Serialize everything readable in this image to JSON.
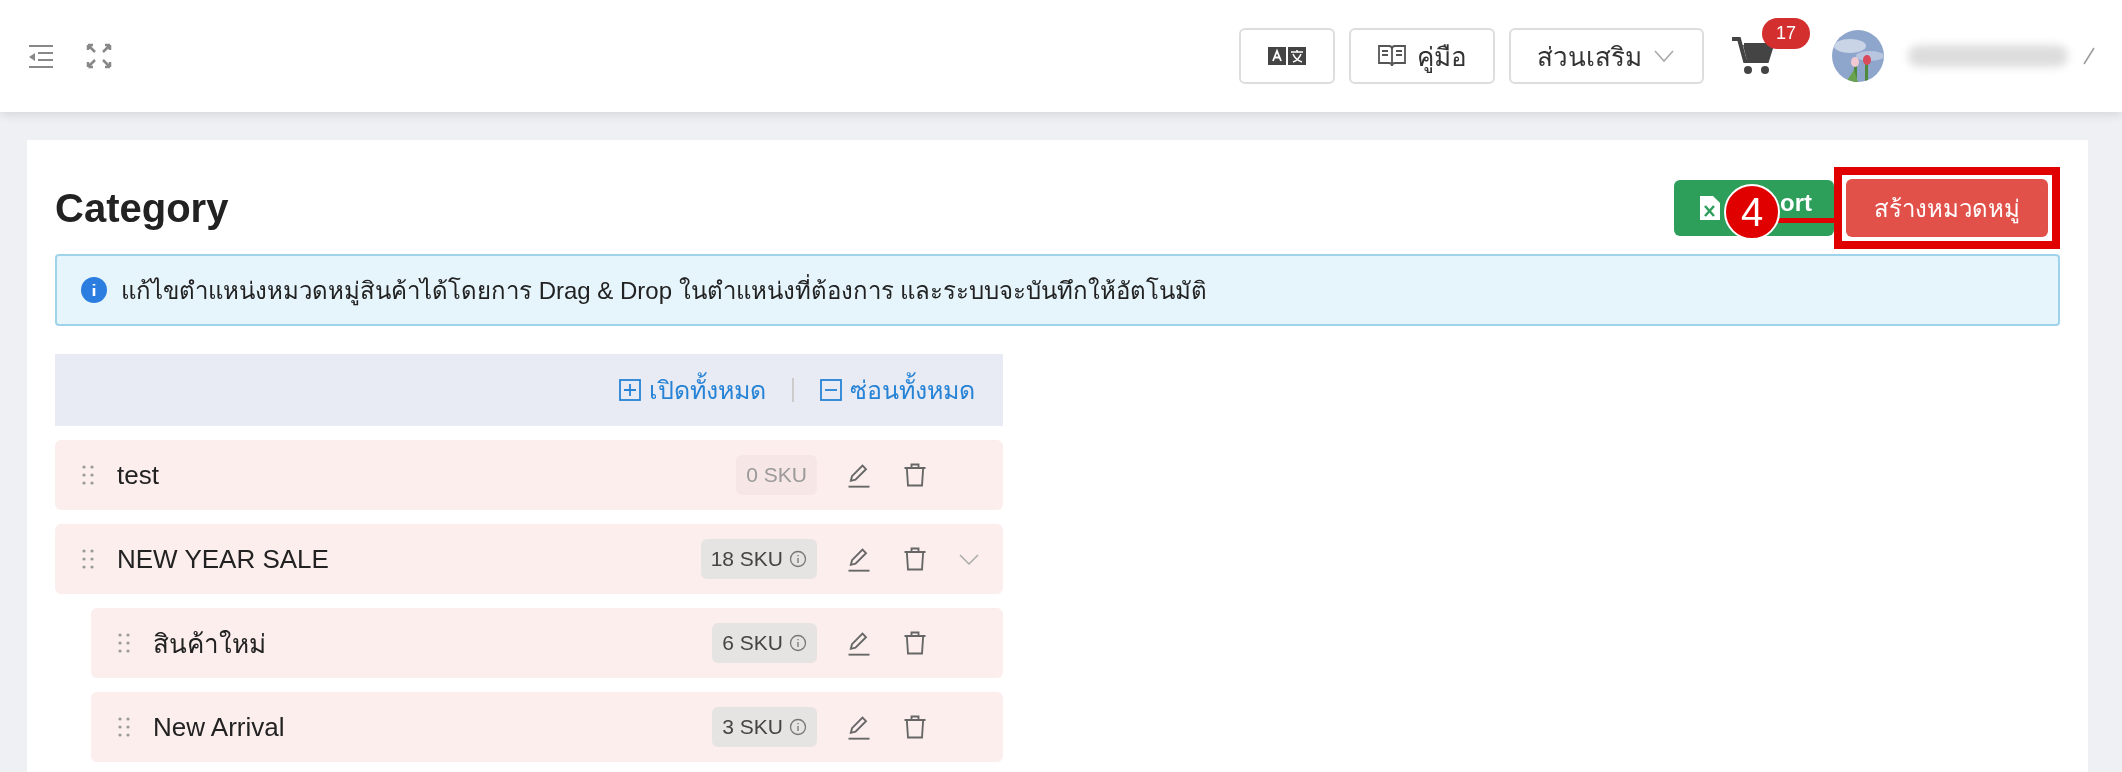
{
  "topbar": {
    "guide_label": "คู่มือ",
    "addons_label": "ส่วนเสริม",
    "cart_count": "17"
  },
  "page": {
    "title": "Category",
    "export_label": "ort",
    "create_label": "สร้างหมวดหมู่",
    "annotation": "4"
  },
  "info": {
    "text": "แก้ไขตำแหน่งหมวดหมู่สินค้าได้โดยการ Drag & Drop ในตำแหน่งที่ต้องการ และระบบจะบันทึกให้อัตโนมัติ"
  },
  "tree": {
    "expand_all": "เปิดทั้งหมด",
    "collapse_all": "ซ่อนทั้งหมด",
    "items": [
      {
        "name": "test",
        "sku": "0 SKU",
        "disabled": true
      },
      {
        "name": "NEW YEAR SALE",
        "sku": "18 SKU",
        "disabled": false,
        "expanded": true,
        "children": [
          {
            "name": "สินค้าใหม่",
            "sku": "6 SKU",
            "disabled": false
          },
          {
            "name": "New Arrival",
            "sku": "3 SKU",
            "disabled": false
          }
        ]
      }
    ]
  }
}
